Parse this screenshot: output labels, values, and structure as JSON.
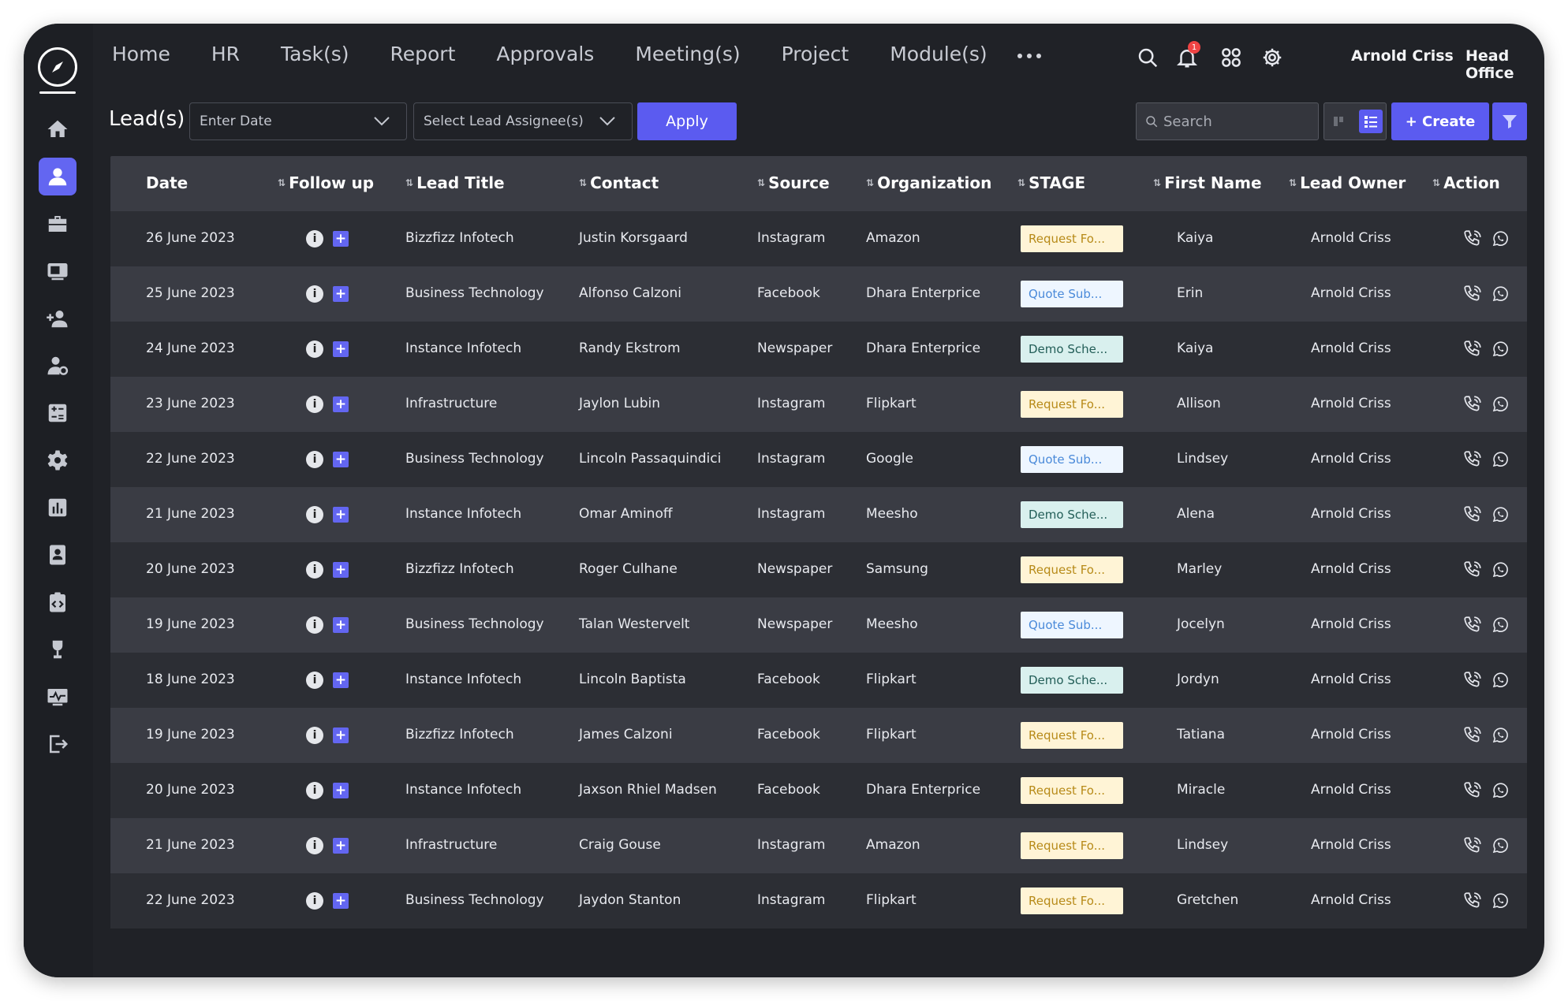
{
  "nav": {
    "menu": [
      "Home",
      "HR",
      "Task(s)",
      "Report",
      "Approvals",
      "Meeting(s)",
      "Project",
      "Module(s)"
    ],
    "notification_count": "1",
    "user_name": "Arnold Criss",
    "office": "Head Office"
  },
  "sidebar": {
    "icons": [
      "home-icon",
      "user-icon",
      "briefcase-icon",
      "monitor-icon",
      "add-user-icon",
      "user-settings-icon",
      "calculator-icon",
      "gear-icon",
      "bar-chart-icon",
      "id-card-icon",
      "clipboard-code-icon",
      "trophy-icon",
      "analytics-icon",
      "logout-icon"
    ],
    "active": "user-icon"
  },
  "toolbar": {
    "title": "Lead(s)",
    "date_placeholder": "Enter Date",
    "assignee_placeholder": "Select Lead Assignee(s)",
    "apply_label": "Apply",
    "search_placeholder": "Search",
    "create_label": "+ Create"
  },
  "table": {
    "columns": [
      "Date",
      "Follow up",
      "Lead Title",
      "Contact",
      "Source",
      "Organization",
      "STAGE",
      "First Name",
      "Lead Owner",
      "Action"
    ],
    "rows": [
      {
        "date": "26 June 2023",
        "title": "Bizzfizz Infotech",
        "contact": "Justin Korsgaard",
        "source": "Instagram",
        "org": "Amazon",
        "stage": "Request Fo...",
        "stage_type": "request",
        "first": "Kaiya",
        "owner": "Arnold Criss"
      },
      {
        "date": "25 June 2023",
        "title": "Business Technology",
        "contact": "Alfonso Calzoni",
        "source": "Facebook",
        "org": "Dhara Enterprice",
        "stage": "Quote Sub...",
        "stage_type": "quote",
        "first": "Erin",
        "owner": "Arnold Criss"
      },
      {
        "date": "24 June 2023",
        "title": "Instance Infotech",
        "contact": "Randy Ekstrom",
        "source": "Newspaper",
        "org": "Dhara Enterprice",
        "stage": "Demo Sche...",
        "stage_type": "demo",
        "first": "Kaiya",
        "owner": "Arnold Criss"
      },
      {
        "date": "23 June 2023",
        "title": "Infrastructure",
        "contact": "Jaylon Lubin",
        "source": "Instagram",
        "org": "Flipkart",
        "stage": "Request Fo...",
        "stage_type": "request",
        "first": "Allison",
        "owner": "Arnold Criss"
      },
      {
        "date": "22 June 2023",
        "title": "Business Technology",
        "contact": "Lincoln Passaquindici",
        "source": "Instagram",
        "org": "Google",
        "stage": "Quote Sub...",
        "stage_type": "quote",
        "first": "Lindsey",
        "owner": "Arnold Criss"
      },
      {
        "date": "21 June 2023",
        "title": "Instance Infotech",
        "contact": "Omar Aminoff",
        "source": "Instagram",
        "org": "Meesho",
        "stage": "Demo Sche...",
        "stage_type": "demo",
        "first": "Alena",
        "owner": "Arnold Criss"
      },
      {
        "date": "20 June 2023",
        "title": "Bizzfizz Infotech",
        "contact": "Roger Culhane",
        "source": "Newspaper",
        "org": "Samsung",
        "stage": "Request Fo...",
        "stage_type": "request",
        "first": "Marley",
        "owner": "Arnold Criss"
      },
      {
        "date": "19 June 2023",
        "title": "Business Technology",
        "contact": "Talan Westervelt",
        "source": "Newspaper",
        "org": "Meesho",
        "stage": "Quote Sub...",
        "stage_type": "quote",
        "first": "Jocelyn",
        "owner": "Arnold Criss"
      },
      {
        "date": "18 June 2023",
        "title": "Instance Infotech",
        "contact": "Lincoln Baptista",
        "source": "Facebook",
        "org": "Flipkart",
        "stage": "Demo Sche...",
        "stage_type": "demo",
        "first": "Jordyn",
        "owner": "Arnold Criss"
      },
      {
        "date": "19 June 2023",
        "title": "Bizzfizz Infotech",
        "contact": "James Calzoni",
        "source": "Facebook",
        "org": "Flipkart",
        "stage": "Request Fo...",
        "stage_type": "request",
        "first": "Tatiana",
        "owner": "Arnold Criss"
      },
      {
        "date": "20 June 2023",
        "title": "Instance Infotech",
        "contact": "Jaxson Rhiel Madsen",
        "source": "Facebook",
        "org": "Dhara Enterprice",
        "stage": "Request Fo...",
        "stage_type": "request",
        "first": "Miracle",
        "owner": "Arnold Criss"
      },
      {
        "date": "21 June 2023",
        "title": "Infrastructure",
        "contact": "Craig Gouse",
        "source": "Instagram",
        "org": "Amazon",
        "stage": "Request Fo...",
        "stage_type": "request",
        "first": "Lindsey",
        "owner": "Arnold Criss"
      },
      {
        "date": "22 June 2023",
        "title": "Business Technology",
        "contact": "Jaydon Stanton",
        "source": "Instagram",
        "org": "Flipkart",
        "stage": "Request Fo...",
        "stage_type": "request",
        "first": "Gretchen",
        "owner": "Arnold Criss"
      }
    ]
  },
  "colors": {
    "accent": "#5b5bf0",
    "background": "#202227"
  }
}
